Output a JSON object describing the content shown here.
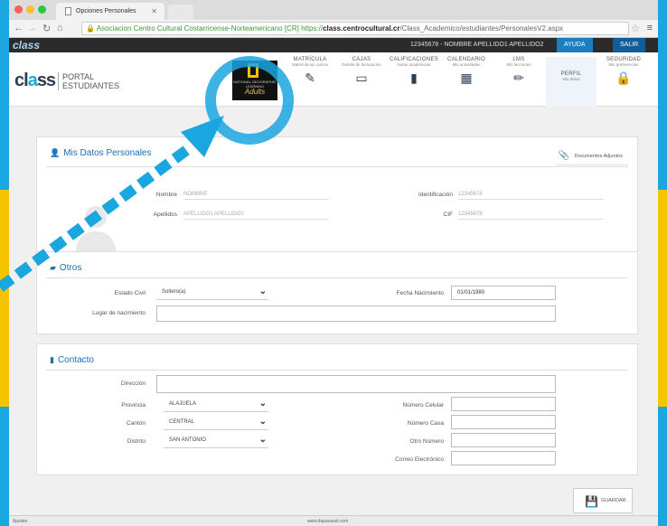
{
  "browser": {
    "tab_title": "Opciones Personales",
    "url_secure_label": "Asociacion Centro Cultural Costarricense-Norteamericano [CR]",
    "url_scheme": "https://",
    "url_host": "class.centrocultural.cr",
    "url_path": "/Class_Academico/estudiantes/PersonalesV2.aspx"
  },
  "topbar": {
    "logo": "class",
    "user_info": "12345678 - NOMBRE APELLIDO1 APELLIDO2",
    "help": "AYUDA",
    "logout": "SALIR"
  },
  "header": {
    "logo_text": "class",
    "portal_line1": "PORTAL",
    "portal_line2": "ESTUDIANTES",
    "natgeo_title": "NATIONAL GEOGRAPHIC LEARNING",
    "natgeo_adults": "Adults",
    "menu": [
      {
        "title": "MATRÍCULA",
        "sub": "Matricula tus cursos",
        "icon": "edit-icon"
      },
      {
        "title": "CAJAS",
        "sub": "Detalle de facturación",
        "icon": "card-icon"
      },
      {
        "title": "CALIFICACIONES",
        "sub": "Notas académicas",
        "icon": "book-icon"
      },
      {
        "title": "CALENDARIO",
        "sub": "Mis actividades",
        "icon": "calendar-icon"
      },
      {
        "title": "LMS",
        "sub": "Mis lecciones",
        "icon": "pencil-icon"
      },
      {
        "title": "PERFIL",
        "sub": "Mis datos",
        "icon": ""
      },
      {
        "title": "SEGURIDAD",
        "sub": "Mis preferencias",
        "icon": "lock-icon"
      }
    ]
  },
  "personal": {
    "title": "Mis Datos Personales",
    "docs_label": "Documentos Adjuntos",
    "nombre_label": "Nombre",
    "nombre_value": "NOMBRE",
    "apellidos_label": "Apellidos",
    "apellidos_value": "APELLIDO1 APELLIDO2",
    "id_label": "Identificación",
    "id_value": "12345678",
    "cif_label": "CIF",
    "cif_value": "12345678"
  },
  "otros": {
    "title": "Otros",
    "estado_label": "Estado Civil",
    "estado_value": "Soltero(a)",
    "fecha_label": "Fecha Nacimiento",
    "fecha_value": "01/01/1980",
    "lugar_label": "Lugar de nacimiento"
  },
  "contacto": {
    "title": "Contacto",
    "direccion_label": "Dirección",
    "provincia_label": "Provincia",
    "provincia_value": "ALAJUELA",
    "canton_label": "Cantón",
    "canton_value": "CENTRAL",
    "distrito_label": "Distrito",
    "distrito_value": "SAN ANTONIO",
    "celular_label": "Número Celular",
    "casa_label": "Número Casa",
    "otro_label": "Otro Número",
    "correo_label": "Correo Electrónico"
  },
  "actions": {
    "save": "GUARDAR"
  },
  "footer": {
    "left": "Ajustes",
    "center": "www.itapavasol.com"
  },
  "colors": {
    "accent": "#1aa6df",
    "highlight": "#f5c400",
    "dark": "#2c3e50"
  }
}
